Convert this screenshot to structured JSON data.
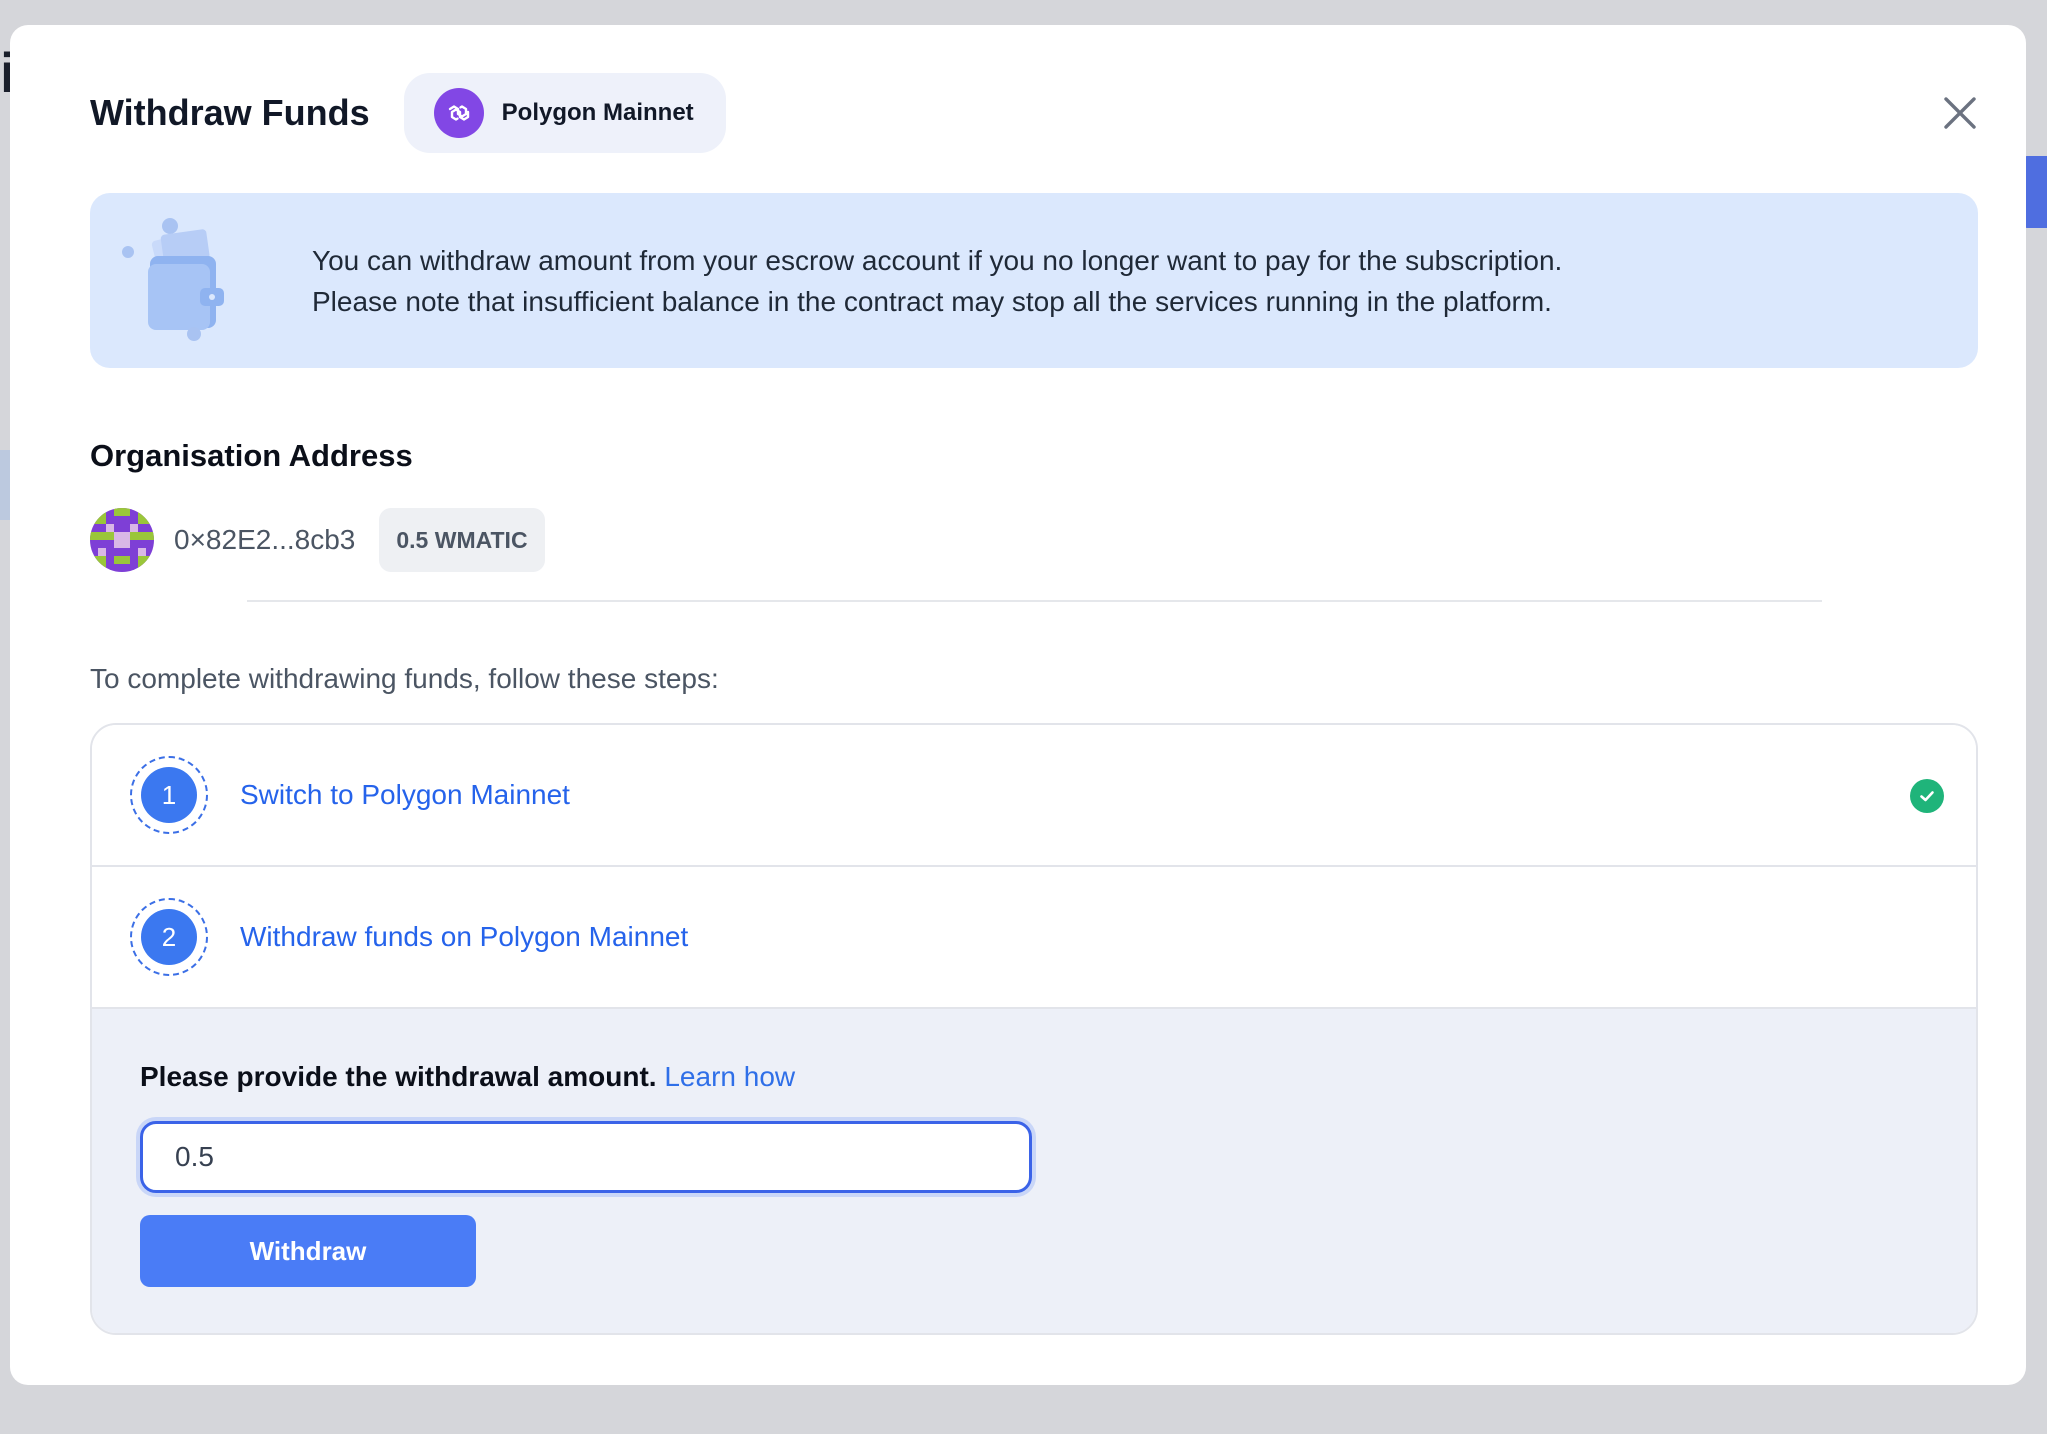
{
  "backdrop": {
    "letter": "i"
  },
  "modal": {
    "title": "Withdraw Funds",
    "network": {
      "label": "Polygon Mainnet",
      "icon": "polygon-logo-icon",
      "color": "#8247e5"
    },
    "close_icon": "close-icon"
  },
  "info": {
    "line1": "You can withdraw amount from your escrow account if you no longer want to pay for the subscription.",
    "line2": "Please note that insufficient balance in the contract may stop all the services running in the platform.",
    "illustration": "wallet-illustration"
  },
  "organisation": {
    "heading": "Organisation Address",
    "address": "0×82E2...8cb3",
    "balance": "0.5 WMATIC"
  },
  "steps_intro": "To complete withdrawing funds, follow these steps:",
  "steps": [
    {
      "number": "1",
      "label": "Switch to Polygon Mainnet",
      "completed": true
    },
    {
      "number": "2",
      "label": "Withdraw funds on Polygon Mainnet",
      "completed": false
    }
  ],
  "withdraw_form": {
    "prompt": "Please provide the withdrawal amount.",
    "learn_link": "Learn how",
    "amount_value": "0.5",
    "button_label": "Withdraw"
  },
  "colors": {
    "accent": "#3b78f0",
    "link": "#2563eb",
    "success": "#1fb47a",
    "banner": "#dbe8fd"
  }
}
